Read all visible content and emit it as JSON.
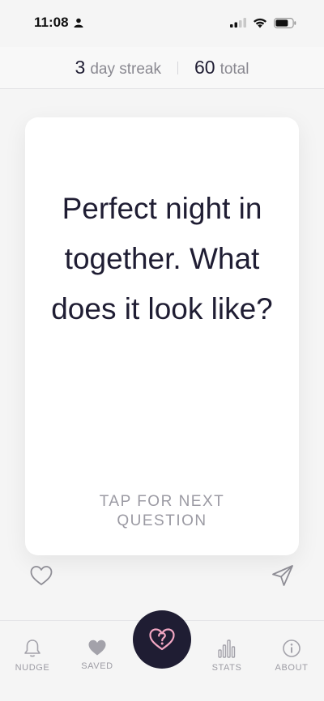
{
  "status_bar": {
    "time": "11:08"
  },
  "header": {
    "streak_value": "3",
    "streak_label": "day streak",
    "total_value": "60",
    "total_label": "total"
  },
  "card": {
    "question": "Perfect night in together. What does it look like?",
    "hint": "TAP FOR NEXT QUESTION"
  },
  "tabbar": {
    "tabs": [
      {
        "label": "NUDGE",
        "icon": "bell-icon"
      },
      {
        "label": "SAVED",
        "icon": "heart-icon"
      },
      {
        "label": "STATS",
        "icon": "bar-chart-icon"
      },
      {
        "label": "ABOUT",
        "icon": "info-icon"
      }
    ],
    "center_icon": "heart-question-icon"
  },
  "colors": {
    "accent_dark": "#1f1d33",
    "accent_pink": "#f2a7c3",
    "muted": "#9d9ca4"
  }
}
